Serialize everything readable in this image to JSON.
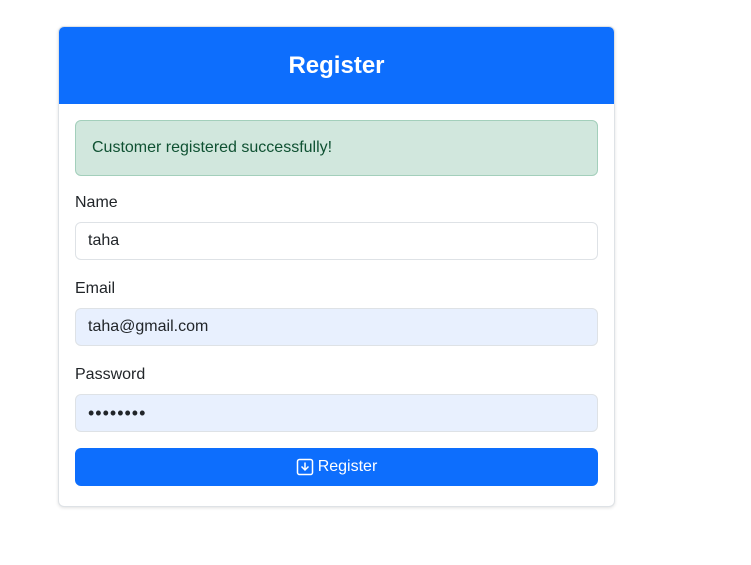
{
  "form": {
    "title": "Register",
    "alert": "Customer registered successfully!",
    "name_label": "Name",
    "name_value": "taha",
    "email_label": "Email",
    "email_value": "taha@gmail.com",
    "password_label": "Password",
    "password_value": "••••••••",
    "submit_label": "Register",
    "submit_icon": "download-box-icon"
  },
  "colors": {
    "primary": "#0d6efd",
    "success_bg": "#d1e7dd",
    "success_text": "#0f5132",
    "autofill_bg": "#e8f0fe"
  }
}
